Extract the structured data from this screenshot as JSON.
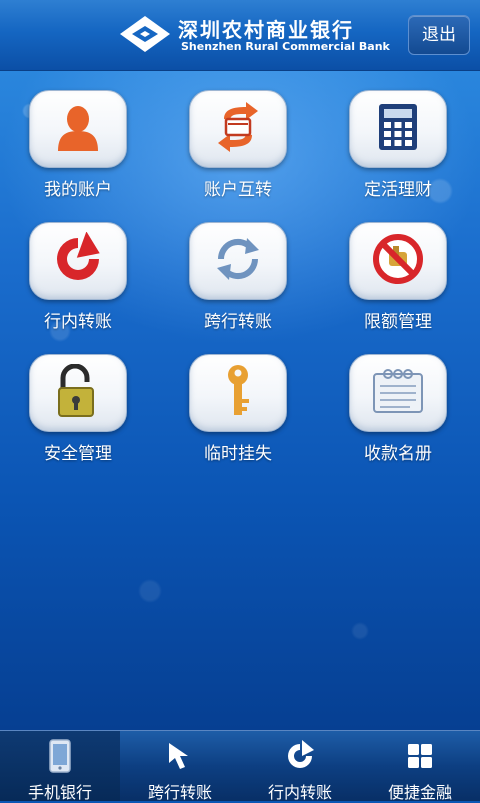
{
  "header": {
    "bank_name_cn": "深圳农村商业银行",
    "bank_name_en": "Shenzhen Rural Commercial Bank",
    "logout_label": "退出"
  },
  "menu": {
    "tiles": [
      {
        "label": "我的账户",
        "icon": "user-icon"
      },
      {
        "label": "账户互转",
        "icon": "transfer-icon"
      },
      {
        "label": "定活理财",
        "icon": "calculator-icon"
      },
      {
        "label": "行内转账",
        "icon": "red-arrow-icon"
      },
      {
        "label": "跨行转账",
        "icon": "refresh-icon"
      },
      {
        "label": "限额管理",
        "icon": "no-icon"
      },
      {
        "label": "安全管理",
        "icon": "lock-icon"
      },
      {
        "label": "临时挂失",
        "icon": "key-icon"
      },
      {
        "label": "收款名册",
        "icon": "notebook-icon"
      }
    ]
  },
  "tabs": [
    {
      "label": "手机银行",
      "icon": "phone-icon",
      "active": true
    },
    {
      "label": "跨行转账",
      "icon": "cursor-arrow-icon",
      "active": false
    },
    {
      "label": "行内转账",
      "icon": "circular-arrow-icon",
      "active": false
    },
    {
      "label": "便捷金融",
      "icon": "grid-icon",
      "active": false
    }
  ],
  "colors": {
    "accent_blue": "#0a56b4",
    "header_blue": "#1566c2",
    "tile_icon_orange": "#e8642a",
    "tile_icon_red": "#d8262a"
  }
}
